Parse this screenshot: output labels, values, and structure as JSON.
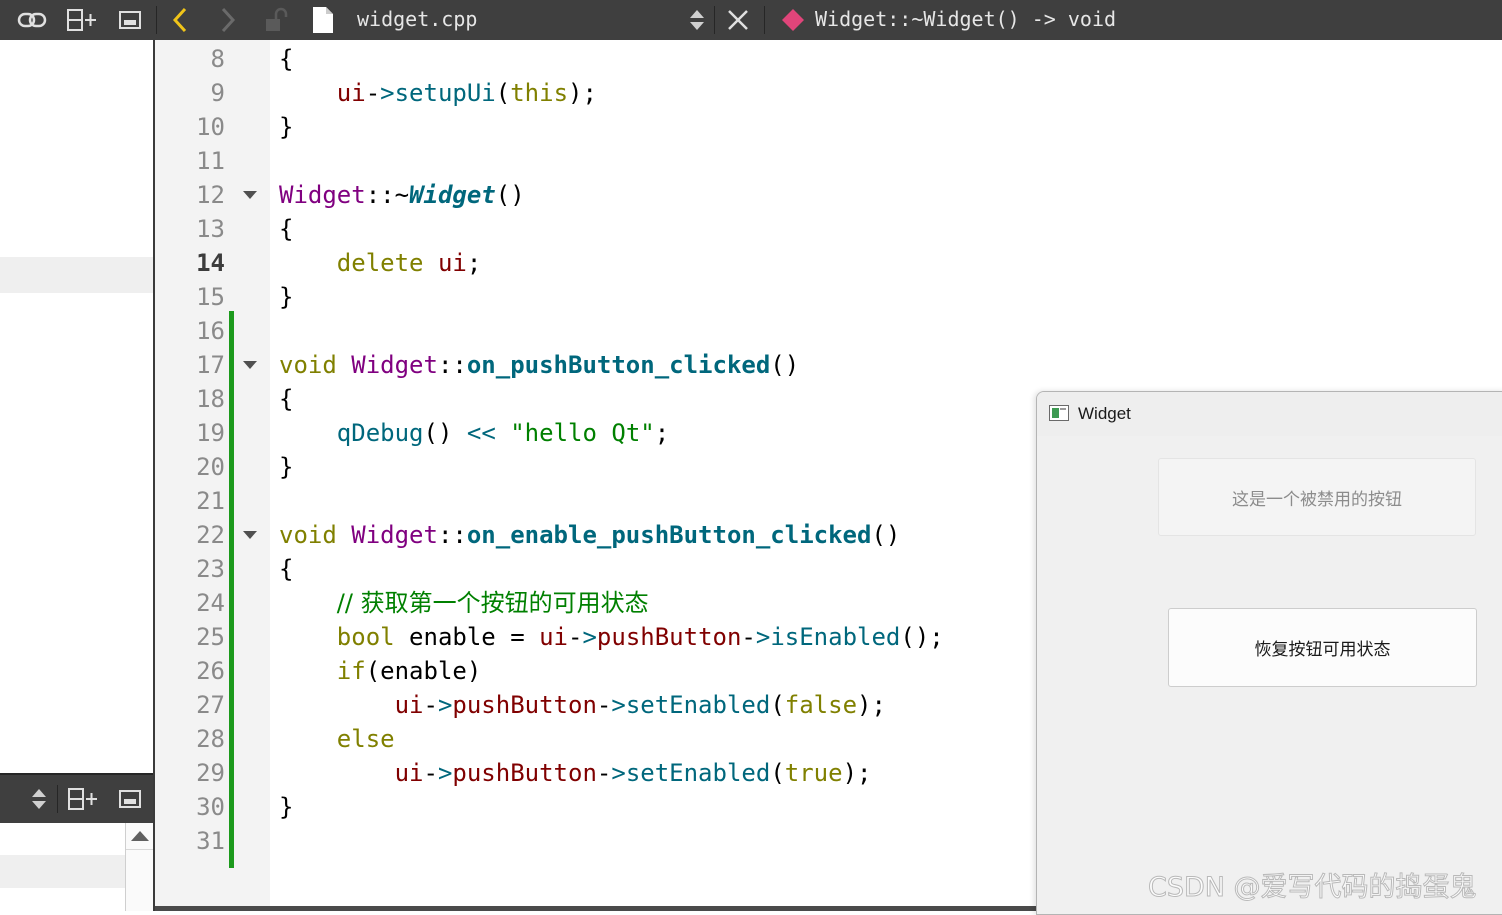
{
  "toolbar": {
    "file_name": "widget.cpp",
    "symbol": "Widget::~Widget() -> void",
    "icons": [
      "link-icon",
      "split-add-icon",
      "window-icon",
      "back-arrow-icon",
      "forward-arrow-icon",
      "lock-icon",
      "file-icon",
      "sort-arrows-icon",
      "close-icon",
      "method-icon"
    ]
  },
  "colors": {
    "toolbar_bg": "#3f3f3f",
    "keyword": "#808000",
    "class": "#800080",
    "function": "#00677c",
    "string": "#008000",
    "comment": "#008000",
    "member": "#800000",
    "change_bar": "#1c9a1c"
  },
  "editor": {
    "current_line": "14",
    "lines": [
      {
        "n": "8",
        "code": "{"
      },
      {
        "n": "9",
        "code": "    ui->setupUi(this);"
      },
      {
        "n": "10",
        "code": "}"
      },
      {
        "n": "11",
        "code": ""
      },
      {
        "n": "12",
        "code": "Widget::~Widget()",
        "fold": true
      },
      {
        "n": "13",
        "code": "{"
      },
      {
        "n": "14",
        "code": "    delete ui;"
      },
      {
        "n": "15",
        "code": "}"
      },
      {
        "n": "16",
        "code": ""
      },
      {
        "n": "17",
        "code": "void Widget::on_pushButton_clicked()",
        "fold": true
      },
      {
        "n": "18",
        "code": "{"
      },
      {
        "n": "19",
        "code": "    qDebug() << \"hello Qt\";"
      },
      {
        "n": "20",
        "code": "}"
      },
      {
        "n": "21",
        "code": ""
      },
      {
        "n": "22",
        "code": "void Widget::on_enable_pushButton_clicked()",
        "fold": true
      },
      {
        "n": "23",
        "code": "{"
      },
      {
        "n": "24",
        "code": "    // 获取第一个按钮的可用状态"
      },
      {
        "n": "25",
        "code": "    bool enable = ui->pushButton->isEnabled();"
      },
      {
        "n": "26",
        "code": "    if(enable)"
      },
      {
        "n": "27",
        "code": "        ui->pushButton->setEnabled(false);"
      },
      {
        "n": "28",
        "code": "    else"
      },
      {
        "n": "29",
        "code": "        ui->pushButton->setEnabled(true);"
      },
      {
        "n": "30",
        "code": "}"
      },
      {
        "n": "31",
        "code": ""
      }
    ]
  },
  "widget_window": {
    "title": "Widget",
    "disabled_button_label": "这是一个被禁用的按钮",
    "restore_button_label": "恢复按钮可用状态"
  },
  "watermark": "CSDN @爱写代码的捣蛋鬼"
}
